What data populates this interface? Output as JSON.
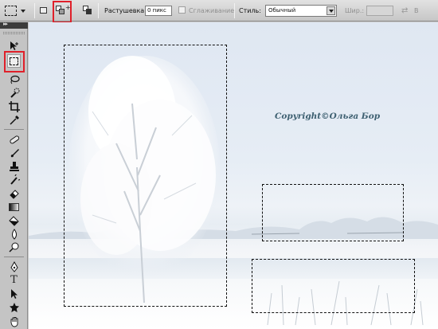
{
  "options_bar": {
    "feather_label": "Растушевка:",
    "feather_value": "0 пикс",
    "antialias_label": "Сглаживание",
    "style_label": "Стиль:",
    "style_value": "Обычный",
    "width_label": "Шир.:",
    "height_label": "В"
  },
  "toolbox": {
    "header_text": "▸▸",
    "tools": [
      "move",
      "rectangular-marquee",
      "lasso",
      "quick-selection",
      "crop",
      "eyedropper",
      "spot-healing",
      "brush",
      "clone-stamp",
      "history-brush",
      "eraser",
      "gradient",
      "paint-bucket",
      "blur",
      "dodge",
      "pen",
      "type",
      "path-selection",
      "custom-shape",
      "hand"
    ]
  },
  "canvas": {
    "watermark": "Copyright©Ольга Бор"
  },
  "colors": {
    "highlight": "#e0202a",
    "watermark": "#3d5f70"
  }
}
